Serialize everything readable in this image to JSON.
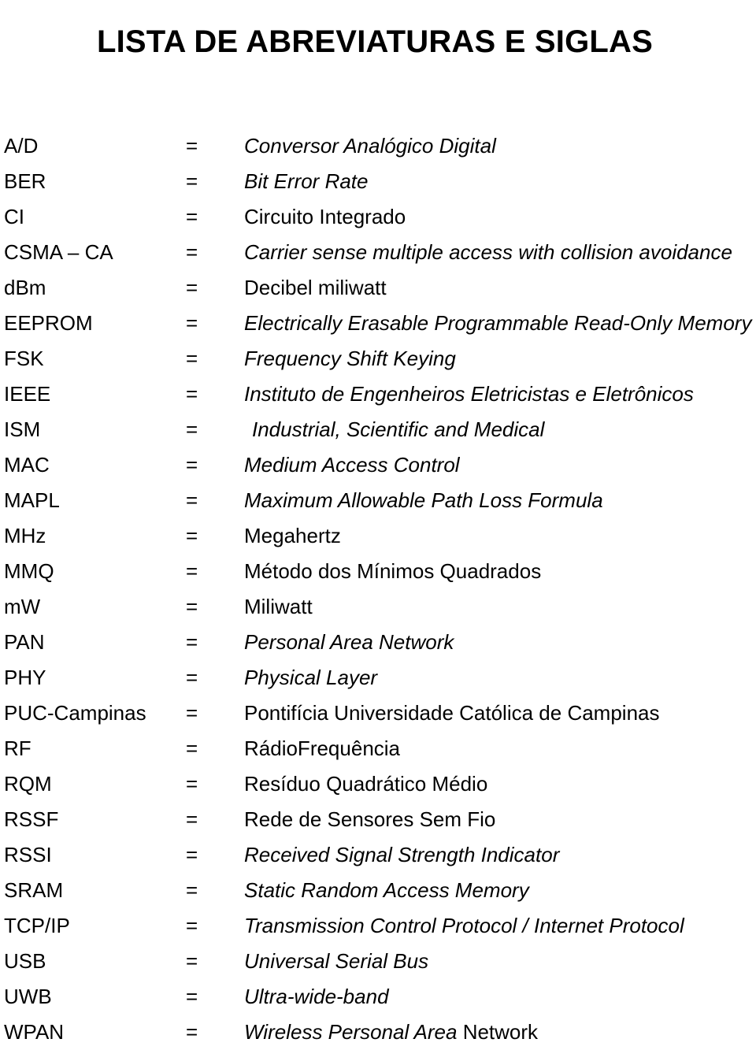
{
  "document": {
    "title": "LISTA DE ABREVIATURAS E SIGLAS",
    "equals_sign": "="
  },
  "entries": [
    {
      "term": "A/D",
      "equals": "=",
      "definition": "Conversor Analógico Digital",
      "style": "italic"
    },
    {
      "term": "BER",
      "equals": "=",
      "definition": "Bit Error Rate",
      "style": "italic"
    },
    {
      "term": "CI",
      "equals": "=",
      "definition": "Circuito Integrado",
      "style": "roman"
    },
    {
      "term": "CSMA – CA",
      "equals": "=",
      "definition": "Carrier sense multiple access with collision avoidance",
      "style": "italic"
    },
    {
      "term": "dBm",
      "equals": "=",
      "definition": "Decibel miliwatt",
      "style": "roman"
    },
    {
      "term": "EEPROM",
      "equals": "=",
      "definition": "Electrically Erasable Programmable Read-Only Memory",
      "style": "italic"
    },
    {
      "term": "FSK",
      "equals": "=",
      "definition": "Frequency Shift Keying",
      "style": "italic"
    },
    {
      "term": "IEEE",
      "equals": "=",
      "definition": "Instituto de Engenheiros Eletricistas e Eletrônicos",
      "style": "italic"
    },
    {
      "term": "ISM",
      "equals": "=",
      "definition": "Industrial, Scientific and Medical",
      "style": "italic",
      "indent": 1
    },
    {
      "term": "MAC",
      "equals": "=",
      "definition": "Medium Access Control",
      "style": "italic"
    },
    {
      "term": "MAPL",
      "equals": "=",
      "definition": "Maximum Allowable Path Loss Formula",
      "style": "italic"
    },
    {
      "term": "MHz",
      "equals": "=",
      "definition": "Megahertz",
      "style": "roman"
    },
    {
      "term": "MMQ",
      "equals": "=",
      "definition": "Método dos Mínimos Quadrados",
      "style": "roman"
    },
    {
      "term": "mW",
      "equals": "=",
      "definition": "Miliwatt",
      "style": "roman"
    },
    {
      "term": "PAN",
      "equals": "=",
      "definition": "Personal Area Network",
      "style": "italic"
    },
    {
      "term": "PHY",
      "equals": "=",
      "definition": "Physical Layer",
      "style": "italic"
    },
    {
      "term": "PUC-Campinas",
      "equals": "=",
      "definition": "Pontifícia Universidade Católica de Campinas",
      "style": "roman"
    },
    {
      "term": "RF",
      "equals": "=",
      "definition": "RádioFrequência",
      "style": "roman"
    },
    {
      "term": "RQM",
      "equals": "=",
      "definition": "Resíduo Quadrático Médio",
      "style": "roman"
    },
    {
      "term": "RSSF",
      "equals": "=",
      "definition": "Rede de Sensores Sem Fio",
      "style": "roman"
    },
    {
      "term": "RSSI",
      "equals": "=",
      "definition": "Received Signal Strength Indicator",
      "style": "italic"
    },
    {
      "term": "SRAM",
      "equals": "=",
      "definition": "Static Random Access Memory",
      "style": "italic"
    },
    {
      "term": "TCP/IP",
      "equals": "=",
      "definition": "Transmission Control Protocol / Internet Protocol",
      "style": "italic"
    },
    {
      "term": "USB",
      "equals": "=",
      "definition": "Universal Serial Bus",
      "style": "italic"
    },
    {
      "term": "UWB",
      "equals": "=",
      "definition": "Ultra-wide-band",
      "style": "italic"
    },
    {
      "term": "WPAN",
      "equals": "=",
      "definition": "Wireless Personal Area Network",
      "style": "mixed",
      "italic_part": "Wireless Personal Area ",
      "roman_part": "Network"
    }
  ]
}
